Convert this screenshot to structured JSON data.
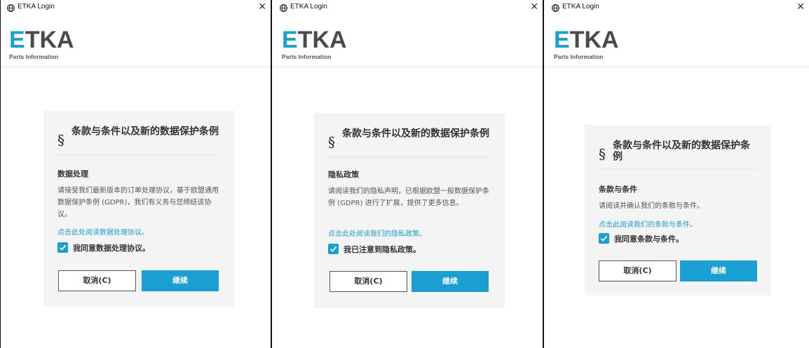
{
  "colors": {
    "accent": "#1a9fd3",
    "card_bg": "#f4f4f4"
  },
  "windows": [
    {
      "title": "ETKA Login",
      "logo": {
        "e": "E",
        "rest": "TKA",
        "sub": "Parts Information"
      },
      "card": {
        "title": "条款与条件以及新的数据保护条例",
        "section_heading": "数据处理",
        "description": "请接受我们最新版本的订单处理协议，基于欧盟通用数据保护条例 (GDPR)，我们有义务与您缔结该协议。",
        "link": "点击此处阅读数据处理协议。",
        "checkbox_label": "我同意数据处理协议。",
        "cancel": "取消(C)",
        "continue": "继续"
      }
    },
    {
      "title": "ETKA Login",
      "logo": {
        "e": "E",
        "rest": "TKA",
        "sub": "Parts Information"
      },
      "card": {
        "title": "条款与条件以及新的数据保护条例",
        "section_heading": "隐私政策",
        "description": "请阅读我们的隐私声明，已根据欧盟一般数据保护条例 (GDPR) 进行了扩展，提供了更多信息。",
        "link": "点击此处阅读我们的隐私政策。",
        "checkbox_label": "我已注意到隐私政策。",
        "cancel": "取消(C)",
        "continue": "继续"
      }
    },
    {
      "title": "ETKA Login",
      "logo": {
        "e": "E",
        "rest": "TKA",
        "sub": "Parts Information"
      },
      "card": {
        "title": "条款与条件以及新的数据保护条例",
        "section_heading": "条款与条件",
        "description": "请阅读并确认我们的条款与条件。",
        "link": "点击此阅读我们的条款与条件。",
        "checkbox_label": "我同意条款与条件。",
        "cancel": "取消(C)",
        "continue": "继续"
      }
    }
  ],
  "icons": {
    "app": "globe-icon",
    "close": "close-icon",
    "section": "section-icon",
    "check": "checkmark-icon"
  },
  "glyphs": {
    "close": "✕",
    "section": "§"
  }
}
